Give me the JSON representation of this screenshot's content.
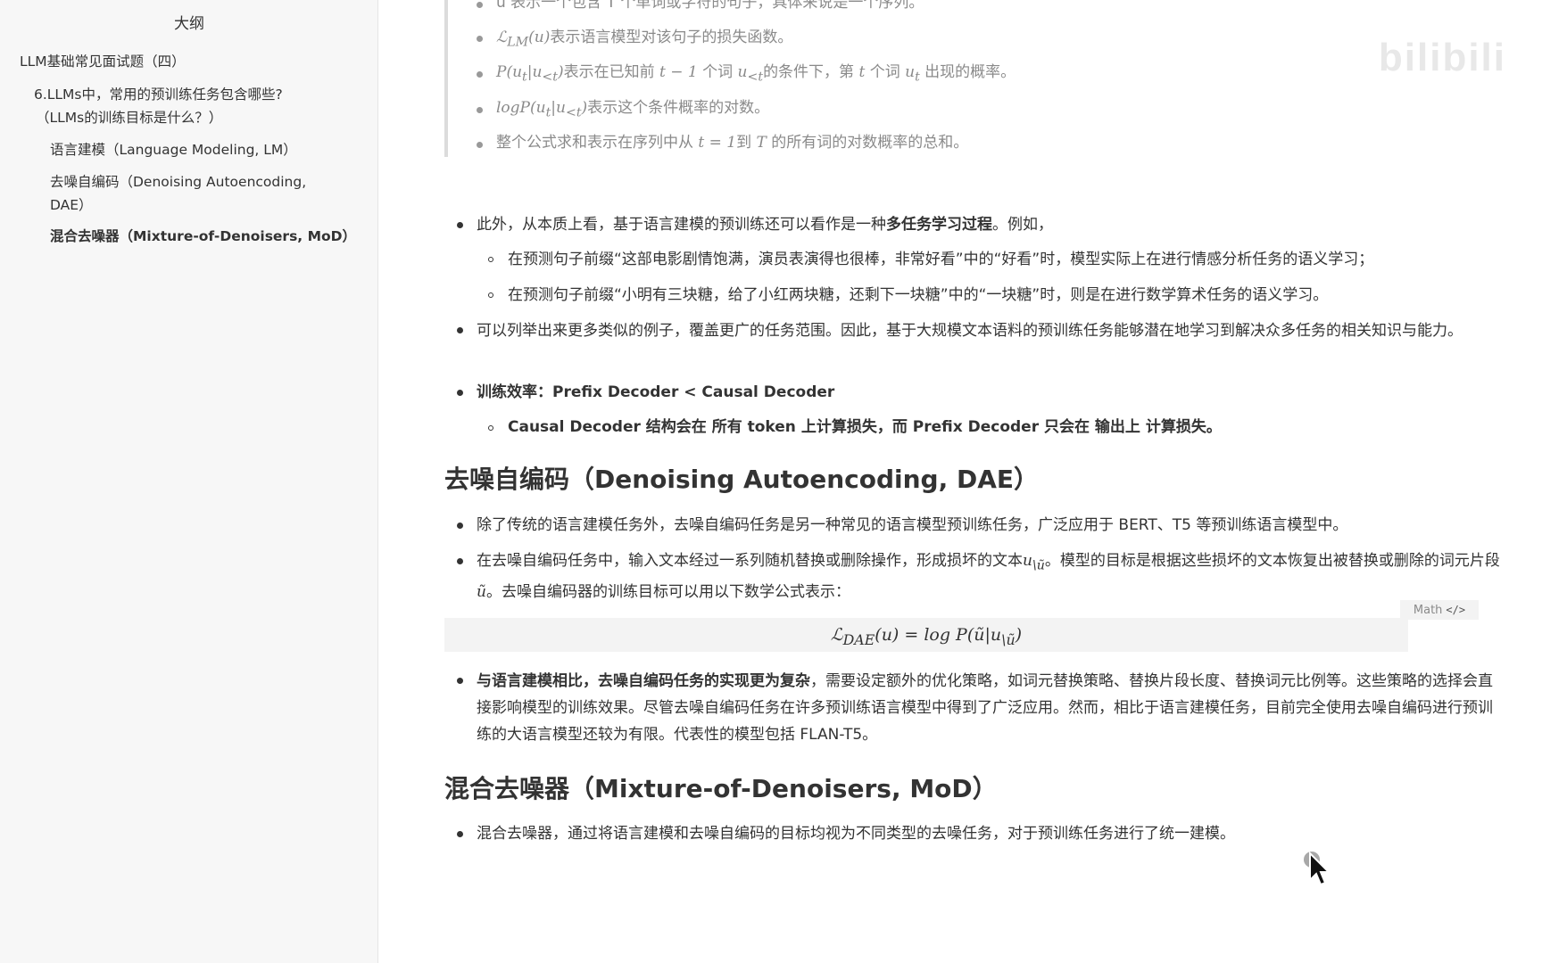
{
  "sidebar": {
    "title": "大纲",
    "items": [
      {
        "label": "LLM基础常见面试题（四）"
      },
      {
        "label": "6.LLMs中，常用的预训练任务包含哪些?"
      },
      {
        "label": "（LLMs的训练目标是什么？）"
      },
      {
        "label": "语言建模（Language Modeling, LM）"
      },
      {
        "label": "去噪自编码（Denoising Autoencoding,"
      },
      {
        "label": "DAE）"
      },
      {
        "label": "混合去噪器（Mixture-of-Denoisers, MoD）"
      }
    ]
  },
  "watermark": "bilibili",
  "quote_items": {
    "i1": "u 表示一个包含 T 个单词或字符的句子，具体来说是一个序列。",
    "i2_math": "ℒ",
    "i2_sub": "LM",
    "i2_math2": "(u)",
    "i2_text": "表示语言模型对该句子的损失函数。",
    "i3_math": "P(u",
    "i3_sub1": "t",
    "i3_mid": "|u",
    "i3_sub2": "<t",
    "i3_end": ")",
    "i3_text_a": "表示在已知前 ",
    "i3_math_b": "t − 1",
    "i3_text_b": " 个词 ",
    "i3_math_c": "u",
    "i3_sub3": "<t",
    "i3_text_c": "的条件下，第 ",
    "i3_math_d": "t",
    "i3_text_d": " 个词 ",
    "i3_math_e": "u",
    "i3_sub4": "t",
    "i3_text_e": " 出现的概率。",
    "i4_math": "logP(u",
    "i4_sub1": "t",
    "i4_mid": "|u",
    "i4_sub2": "<t",
    "i4_end": ")",
    "i4_text": "表示这个条件概率的对数。",
    "i5_text_a": "整个公式求和表示在序列中从 ",
    "i5_math": "t = 1",
    "i5_text_b": "到 ",
    "i5_math2": "T",
    "i5_text_c": " 的所有词的对数概率的总和。"
  },
  "lm_section": {
    "p1_a": "此外，从本质上看，基于语言建模的预训练还可以看作是一种",
    "p1_bold": "多任务学习过程",
    "p1_b": "。例如，",
    "sub1": "在预测句子前缀“这部电影剧情饱满，演员表演得也很棒，非常好看”中的“好看”时，模型实际上在进行情感分析任务的语义学习；",
    "sub2": "在预测句子前缀“小明有三块糖，给了小红两块糖，还剩下一块糖”中的“一块糖”时，则是在进行数学算术任务的语义学习。",
    "p2": "可以列举出来更多类似的例子，覆盖更广的任务范围。因此，基于大规模文本语料的预训练任务能够潜在地学习到解决众多任务的相关知识与能力。",
    "p3": "训练效率：Prefix Decoder < Causal Decoder",
    "p3_sub": "Causal Decoder 结构会在 所有 token 上计算损失，而 Prefix Decoder 只会在 输出上 计算损失。"
  },
  "dae_section": {
    "heading": "去噪自编码（Denoising Autoencoding, DAE）",
    "p1": "除了传统的语言建模任务外，去噪自编码任务是另一种常见的语言模型预训练任务，广泛应用于 BERT、T5 等预训练语言模型中。",
    "p2_a": "在去噪自编码任务中，输入文本经过一系列随机替换或删除操作，形成损坏的文本",
    "p2_math": "u",
    "p2_sub": "\\ũ",
    "p2_b": "。模型的目标是根据这些损坏的文本恢复出被替换或删除的词元片段 ",
    "p2_math2": "ũ",
    "p2_c": "。去噪自编码器的训练目标可以用以下数学公式表示：",
    "math_tab": "Math",
    "math_tab_icon": "</>",
    "formula_lhs": "ℒ",
    "formula_sub": "DAE",
    "formula_rest": "(u) = log P(ũ|u",
    "formula_sub2": "\\ũ",
    "formula_end": ")",
    "p3_bold": "与语言建模相比，去噪自编码任务的实现更为复杂",
    "p3_a": "，需要设定额外的优化策略，如词元替换策略、替换片段长度、替换词元比例等。这些策略的选择会直接影响模型的训练效果。尽管去噪自编码任务在许多预训练语言模型中得到了广泛应用。然而，相比于语言建模任务，目前完全使用去噪自编码进行预训练的大语言模型还较为有限。代表性的模型包括 FLAN-T5。"
  },
  "mod_section": {
    "heading": "混合去噪器（Mixture-of-Denoisers, MoD）",
    "p1": "混合去噪器，通过将语言建模和去噪自编码的目标均视为不同类型的去噪任务，对于预训练任务进行了统一建模。"
  }
}
